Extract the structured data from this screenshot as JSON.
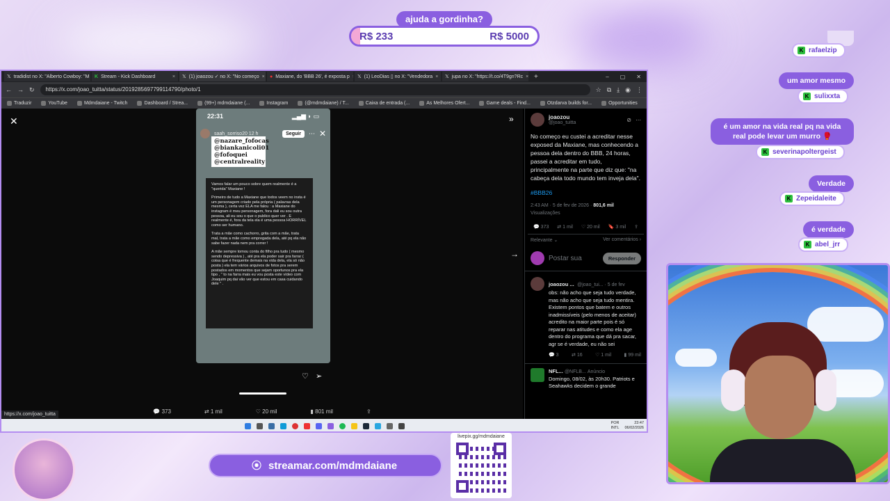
{
  "goal": {
    "title": "ajuda a gordinha?",
    "current": "R$ 233",
    "target": "R$ 5000",
    "progress_fraction": 0.047
  },
  "browser": {
    "tabs": [
      {
        "label": "tradidist no X: \"Alberto Cowboy: \"M"
      },
      {
        "label": "Stream - Kick Dashboard"
      },
      {
        "label": "(1) joaozou ✓ no X: \"No começo"
      },
      {
        "label": "Maxiane, do 'BBB 26', é exposta p"
      },
      {
        "label": "(1) LeoDias ▯ no X: \"Vendedora"
      },
      {
        "label": "jupa no X: \"https://t.co/4T9gn?Rc"
      }
    ],
    "url": "https://x.com/joao_tuitta/status/2019285697799114790/photo/1",
    "bookmarks": [
      "Traduzir",
      "YouTube",
      "Mdmdaiane - Twitch",
      "Dashboard / Strea...",
      "(99+) mdmdaiane (...",
      "Instagram",
      "(@mdmdaiane) / T...",
      "Caixa de entrada (...",
      "As Melhores Ofert...",
      "Game deals - Find...",
      "Otzdarva builds for...",
      "Opportunities"
    ],
    "hover_url": "https://x.com/joao_tuitta"
  },
  "story": {
    "time": "22:31",
    "user": "saah_sorriso20 12 h",
    "follow": "Seguir",
    "tags": [
      "@nazare_fofocas",
      "@biankanicoli01",
      "@fofoquei",
      "@centralreality"
    ],
    "paragraphs": [
      "Vamos falar um pouco sobre quem realmente é a \"querida\" Maxiane !",
      "Primeiro de tudo a Maxiane que todos veem no insta é um personagem criado pela própria ( palavras dela mesma ), certa vez ELA me falou : a Maxiane do instagram é meu personagem, fora dali eu sou outra pessoa, ali eu sou o que o publico quer ver . E realmente é, fora da tela ela é uma pessoa HORRÍVEL como ser humano.",
      "Trata a mãe como cachorro, grita com a mãe, trata mal, trata a mãe como empregada dela, até pq ela não sabe fazer nada nem pra correr !",
      "A mãe sempre tomou conta do filho pra tudo ( mesmo sendo depressiva ) , até pra ela poder sair pra farrar ( coisa que é frequente demais na vida dela, ela só não posta ) ela tem vários arquivos de fotos pra serem postados em momentos que sejam oportunos pra ela tipo , \" to na farra mais eu vou posta este vídeo com Joaquim pq dai vão ver que estou em casa cuidando dele \" ."
    ]
  },
  "actions": {
    "replies": "373",
    "reposts": "1 mil",
    "likes": "20 mil",
    "views": "801 mil"
  },
  "tweet": {
    "author": "joaozou",
    "handle": "@joao_tuitta",
    "text": "No começo eu custei a acreditar nesse exposed da Maxiane, mas conhecendo a pessoa dela dentro do BBB, 24 horas, passei a acreditar em tudo, principalmente na parte que diz que: \"na cabeça dela todo mundo tem inveja dela\".",
    "hashtag": "#BBB26",
    "timestamp": "2:43 AM · 5 de fev de 2026 · ",
    "views_count": "801,6 mil",
    "views_label": "Visualizações",
    "stats": {
      "replies": "373",
      "reposts": "1 mil",
      "likes": "20 mil",
      "bookmarks": "3 mil"
    },
    "sort": "Relevante",
    "see_replies": "Ver comentários",
    "reply_placeholder": "Postar sua",
    "reply_button": "Responder"
  },
  "reply": {
    "author": "joaozou ...",
    "handle": "@joao_tui... · 5 de fev",
    "text": "obs: não acho que seja tudo verdade, mas não acho que seja tudo mentira. Existem pontos que batem e outros inadmissíveis (pelo menos de aceitar) acredito na maior parte pois é só reparar nas atitudes e como ela age dentro do programa que dá pra sacar, agr se é verdade, eu não sei",
    "stats": {
      "replies": "3",
      "reposts": "16",
      "likes": "1 mil",
      "views": "99 mil"
    }
  },
  "ad": {
    "author": "NFL...",
    "handle": "@NFLB...",
    "label": "Anúncio",
    "text": "Domingo, 08/02, às 20h30. Patriots e Seahawks decidem o grande"
  },
  "taskbar": {
    "lang": "POR",
    "layout": "INTL",
    "time": "23:47",
    "date": "06/02/2026"
  },
  "chat": [
    {
      "type": "user",
      "text": "rafaelzip"
    },
    {
      "type": "msg",
      "text": "um amor mesmo"
    },
    {
      "type": "user",
      "text": "sulixxta"
    },
    {
      "type": "msg",
      "text": "é um amor na vida real pq na vida real pode levar um murro"
    },
    {
      "type": "user",
      "text": "severinapoltergeist"
    },
    {
      "type": "msg",
      "text": "Verdade"
    },
    {
      "type": "user",
      "text": "Zepeidaleite"
    },
    {
      "type": "msg",
      "text": "é verdade"
    },
    {
      "type": "user",
      "text": "abel_jrr"
    }
  ],
  "footer": {
    "streamar": "streamar.com/mdmdaiane",
    "qr_label": "livepix.gg/mdmdaiane"
  },
  "colors": {
    "accent": "#8a5fe0",
    "x_blue": "#1d9bf0",
    "kick_green": "#2cbf3e"
  }
}
